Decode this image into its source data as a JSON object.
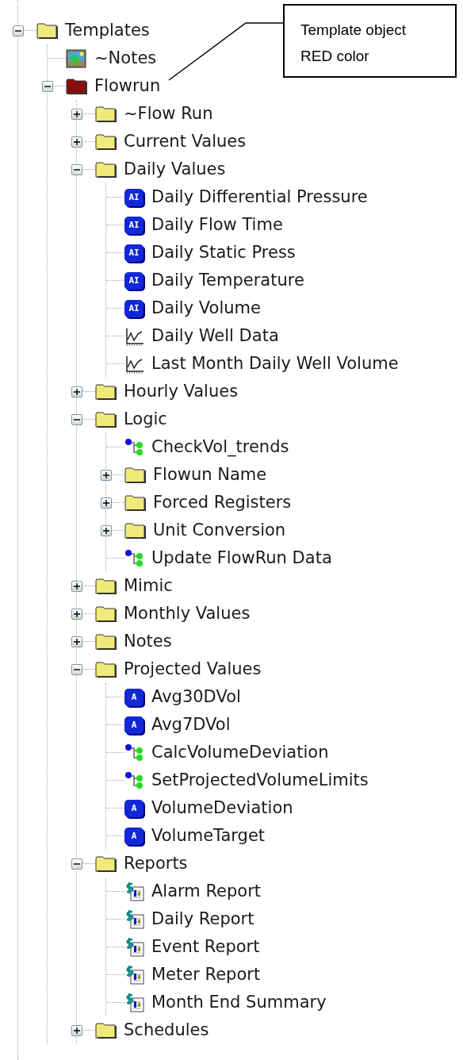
{
  "tree": [
    {
      "label": "Templates",
      "kind": "folder",
      "expanded": true,
      "children": [
        {
          "label": "~Notes",
          "kind": "notes"
        },
        {
          "label": "Flowrun",
          "kind": "template-folder",
          "expanded": true,
          "children": [
            {
              "label": "~Flow Run",
              "kind": "folder",
              "expanded": false
            },
            {
              "label": "Current Values",
              "kind": "folder",
              "expanded": false
            },
            {
              "label": "Daily Values",
              "kind": "folder",
              "expanded": true,
              "children": [
                {
                  "label": "Daily Differential Pressure",
                  "kind": "badge",
                  "badge": "AI"
                },
                {
                  "label": "Daily Flow Time",
                  "kind": "badge",
                  "badge": "AI"
                },
                {
                  "label": "Daily Static Press",
                  "kind": "badge",
                  "badge": "AI"
                },
                {
                  "label": "Daily Temperature",
                  "kind": "badge",
                  "badge": "AI"
                },
                {
                  "label": "Daily Volume",
                  "kind": "badge",
                  "badge": "AI"
                },
                {
                  "label": "Daily Well Data",
                  "kind": "trend"
                },
                {
                  "label": "Last Month Daily Well Volume",
                  "kind": "trend"
                }
              ]
            },
            {
              "label": "Hourly Values",
              "kind": "folder",
              "expanded": false
            },
            {
              "label": "Logic",
              "kind": "folder",
              "expanded": true,
              "children": [
                {
                  "label": "CheckVol_trends",
                  "kind": "logic"
                },
                {
                  "label": "Flowun Name",
                  "kind": "folder",
                  "expanded": false
                },
                {
                  "label": "Forced Registers",
                  "kind": "folder",
                  "expanded": false
                },
                {
                  "label": "Unit Conversion",
                  "kind": "folder",
                  "expanded": false
                },
                {
                  "label": "Update FlowRun Data",
                  "kind": "logic"
                }
              ]
            },
            {
              "label": "Mimic",
              "kind": "folder",
              "expanded": false
            },
            {
              "label": "Monthly Values",
              "kind": "folder",
              "expanded": false
            },
            {
              "label": "Notes",
              "kind": "folder",
              "expanded": false
            },
            {
              "label": "Projected Values",
              "kind": "folder",
              "expanded": true,
              "children": [
                {
                  "label": "Avg30DVol",
                  "kind": "badge",
                  "badge": "A"
                },
                {
                  "label": "Avg7DVol",
                  "kind": "badge",
                  "badge": "A"
                },
                {
                  "label": "CalcVolumeDeviation",
                  "kind": "logic"
                },
                {
                  "label": "SetProjectedVolumeLimits",
                  "kind": "logic"
                },
                {
                  "label": "VolumeDeviation",
                  "kind": "badge",
                  "badge": "A"
                },
                {
                  "label": "VolumeTarget",
                  "kind": "badge",
                  "badge": "A"
                }
              ]
            },
            {
              "label": "Reports",
              "kind": "folder",
              "expanded": true,
              "children": [
                {
                  "label": "Alarm Report",
                  "kind": "report"
                },
                {
                  "label": "Daily Report",
                  "kind": "report"
                },
                {
                  "label": "Event Report",
                  "kind": "report"
                },
                {
                  "label": "Meter Report",
                  "kind": "report"
                },
                {
                  "label": "Month End Summary",
                  "kind": "report"
                }
              ]
            },
            {
              "label": "Schedules",
              "kind": "folder",
              "expanded": false
            }
          ]
        }
      ]
    }
  ],
  "callout": {
    "lines": [
      "Template object",
      "RED color"
    ]
  }
}
